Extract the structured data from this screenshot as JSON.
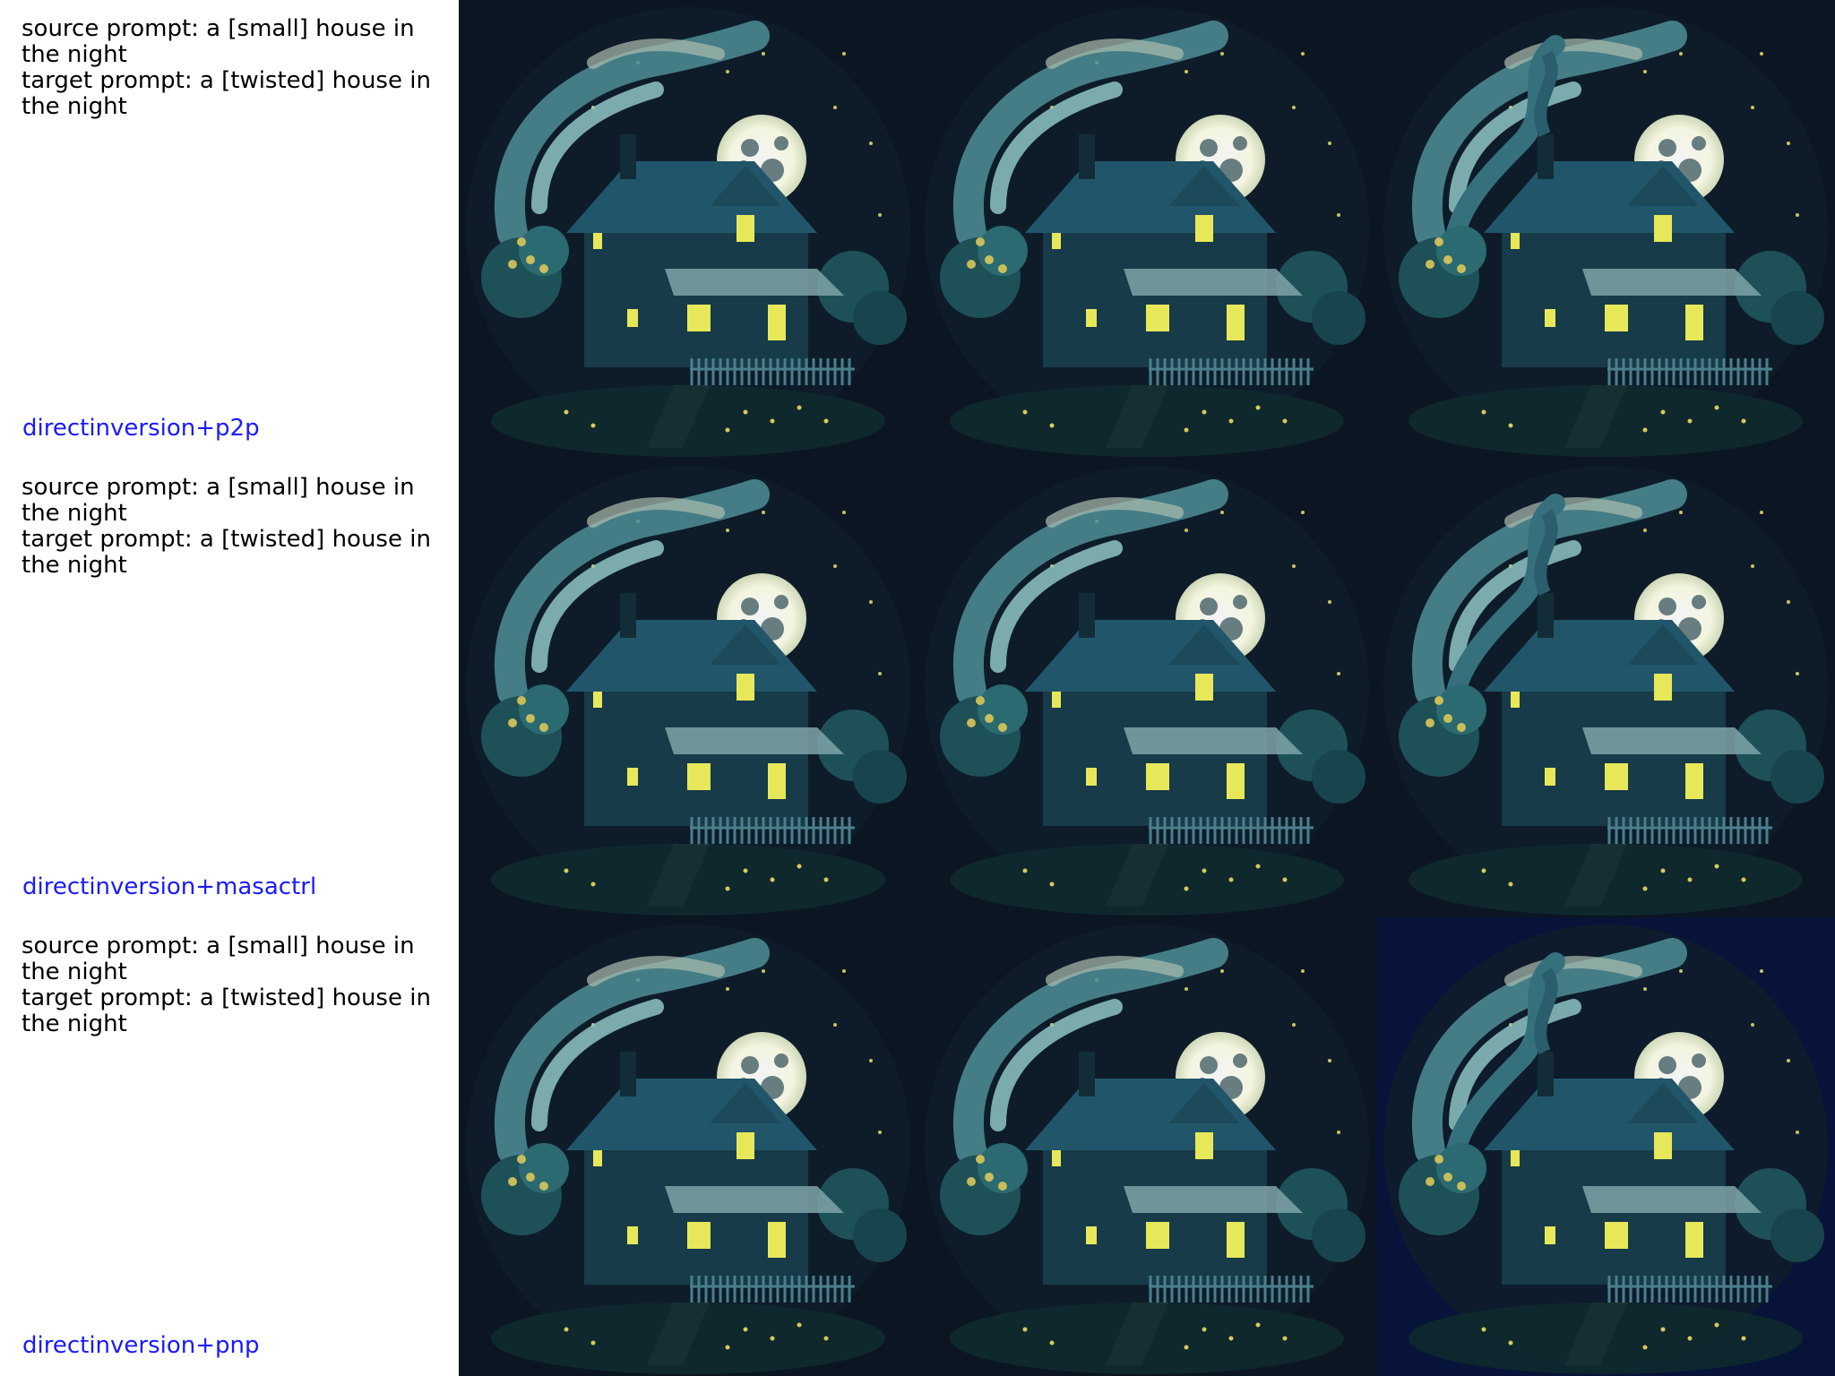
{
  "rows": [
    {
      "source_prompt": "source prompt: a [small] house in the night",
      "target_prompt": "target prompt: a [twisted] house in the night",
      "method": "directinversion+p2p"
    },
    {
      "source_prompt": "source prompt: a [small] house in the night",
      "target_prompt": "target prompt: a [twisted] house in the night",
      "method": "directinversion+masactrl"
    },
    {
      "source_prompt": "source prompt: a [small] house in the night",
      "target_prompt": "target prompt: a [twisted] house in the night",
      "method": "directinversion+pnp"
    }
  ],
  "colors": {
    "method_label": "#1a1aff",
    "prompt_text": "#000000",
    "night_sky": "#0b1622",
    "night_sky_blue": "#071338",
    "moon": "#f3f5e0",
    "swirl": "#4f8f97",
    "house": "#173b48",
    "window_light": "#e7e75a"
  }
}
